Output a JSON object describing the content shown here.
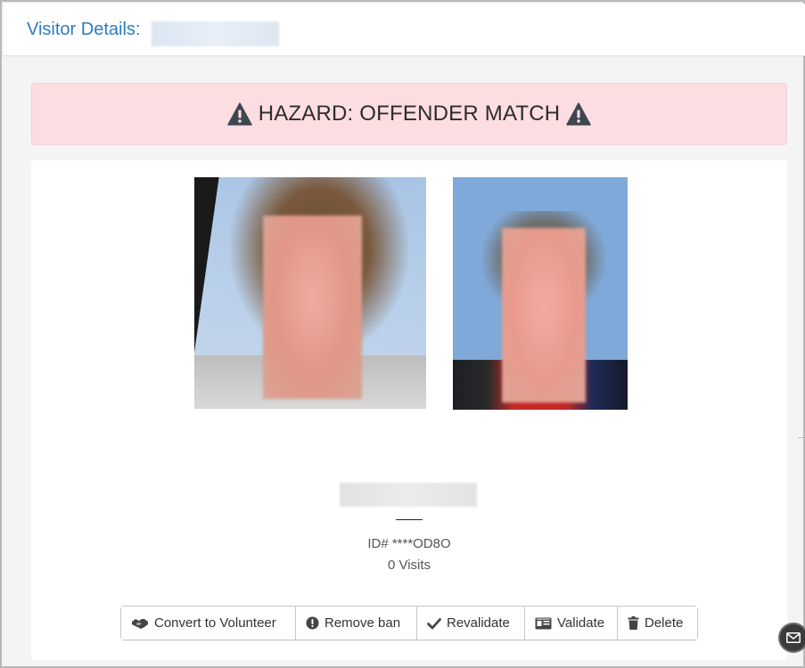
{
  "header": {
    "title": "Visitor Details:"
  },
  "alert": {
    "text": "HAZARD: OFFENDER MATCH",
    "icon": "warning-triangle-icon",
    "bg_color": "#fcdde2"
  },
  "visitor": {
    "id_label": "ID# ****OD8O",
    "visits_label": "0 Visits"
  },
  "actions": [
    {
      "label": "Convert to Volunteer",
      "icon": "handshake-icon"
    },
    {
      "label": "Remove ban",
      "icon": "exclamation-circle-icon"
    },
    {
      "label": "Revalidate",
      "icon": "checkmark-icon"
    },
    {
      "label": "Validate",
      "icon": "id-card-icon"
    },
    {
      "label": "Delete",
      "icon": "trash-icon"
    }
  ],
  "colors": {
    "accent": "#2c7bc0",
    "alert_bg": "#fcdde2",
    "text": "#333333"
  }
}
